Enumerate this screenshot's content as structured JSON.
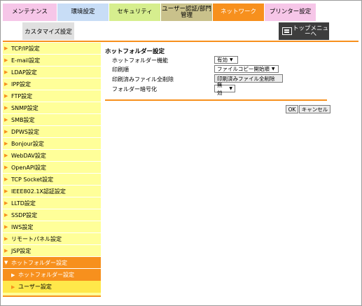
{
  "tabs": [
    {
      "label": "メンテナンス"
    },
    {
      "label": "環境設定"
    },
    {
      "label": "セキュリティ"
    },
    {
      "label": "ユーザー認証/部門管理"
    },
    {
      "label": "ネットワーク"
    },
    {
      "label": "プリンター設定"
    }
  ],
  "tab_row2": {
    "label": "カスタマイズ設定"
  },
  "top_menu": {
    "label": "トップメニューへ"
  },
  "sidebar": {
    "items": [
      {
        "label": "TCP/IP設定"
      },
      {
        "label": "E-mail設定"
      },
      {
        "label": "LDAP設定"
      },
      {
        "label": "IPP設定"
      },
      {
        "label": "FTP設定"
      },
      {
        "label": "SNMP設定"
      },
      {
        "label": "SMB設定"
      },
      {
        "label": "DPWS設定"
      },
      {
        "label": "Bonjour設定"
      },
      {
        "label": "WebDAV設定"
      },
      {
        "label": "OpenAPI設定"
      },
      {
        "label": "TCP Socket設定"
      },
      {
        "label": "IEEE802.1X認証設定"
      },
      {
        "label": "LLTD設定"
      },
      {
        "label": "SSDP設定"
      },
      {
        "label": "IWS設定"
      },
      {
        "label": "リモートパネル設定"
      },
      {
        "label": "JSP設定"
      },
      {
        "label": "ホットフォルダー設定"
      }
    ],
    "subitems": [
      {
        "label": "ホットフォルダー設定"
      },
      {
        "label": "ユーザー設定"
      }
    ]
  },
  "main": {
    "title": "ホットフォルダー設定",
    "rows": [
      {
        "label": "ホットフォルダー機能",
        "value": "有効"
      },
      {
        "label": "印刷順",
        "value": "ファイルコピー開始順"
      },
      {
        "label": "印刷済みファイル全削除",
        "value": "印刷済みファイル全削除"
      },
      {
        "label": "フォルダー暗号化",
        "value": "無効"
      }
    ],
    "ok_label": "OK",
    "cancel_label": "キャンセル"
  },
  "colors": {
    "accent": "#f7901d",
    "sidebar_bg": "#ffff99"
  }
}
